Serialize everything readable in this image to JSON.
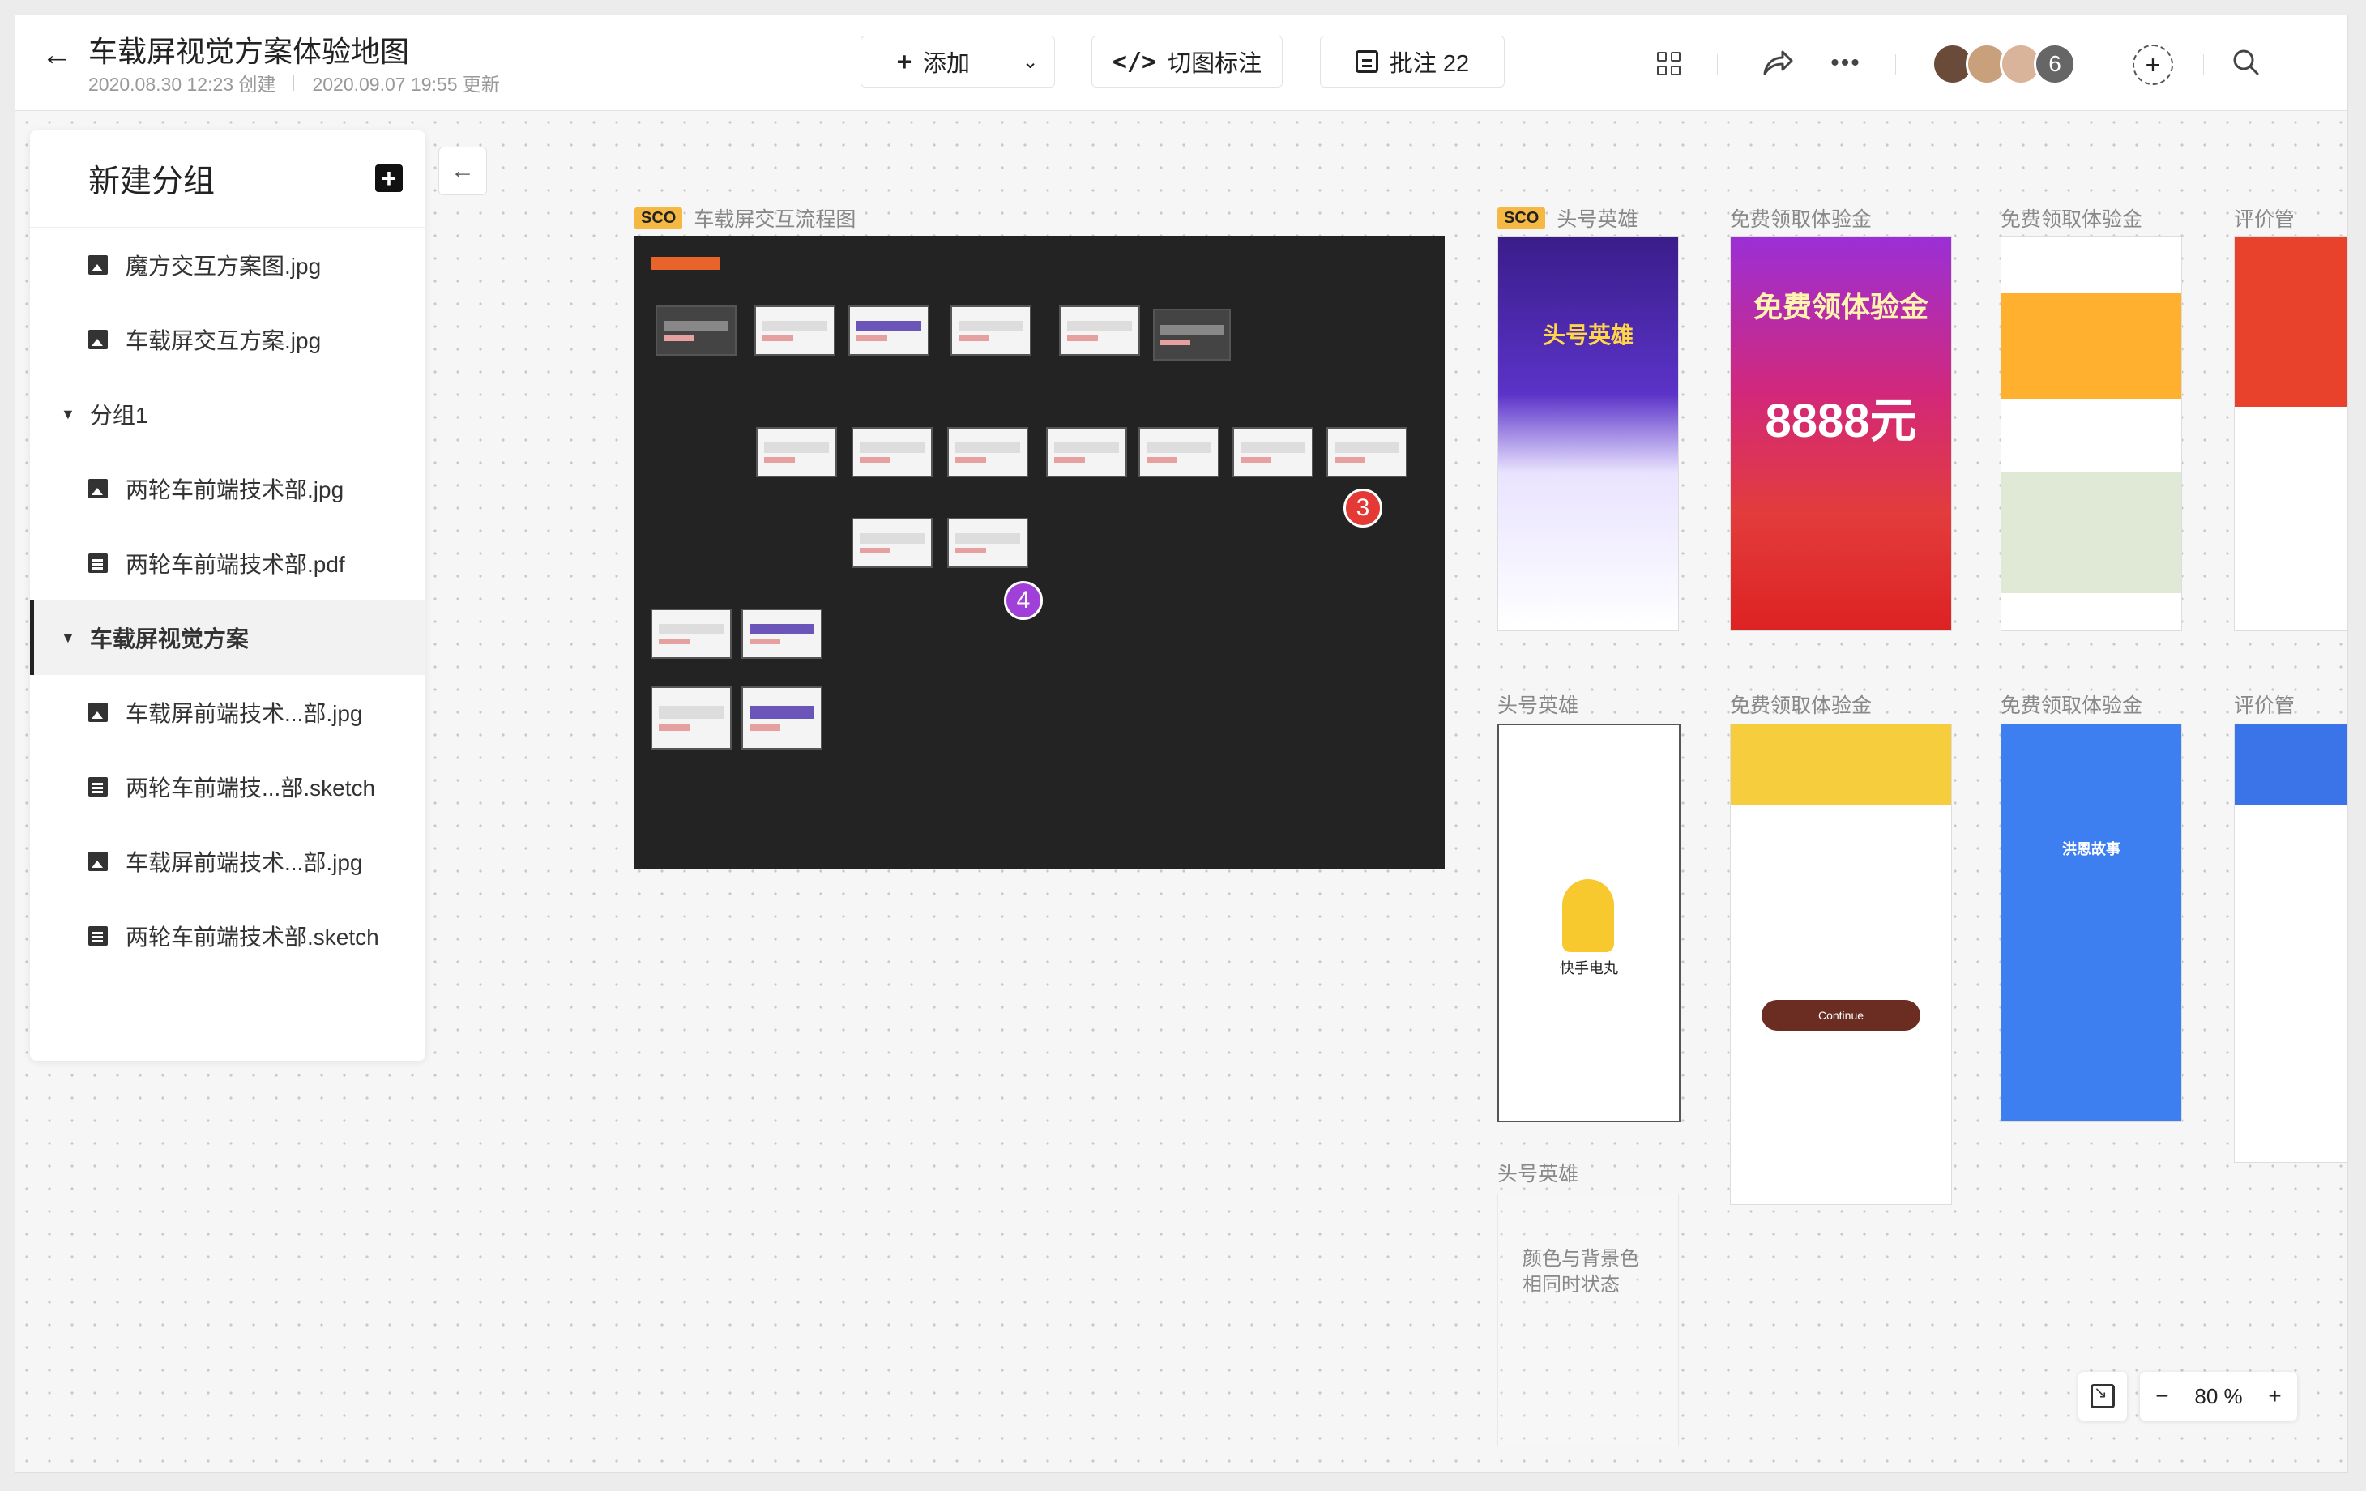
{
  "header": {
    "title": "车载屏视觉方案体验地图",
    "created": "2020.08.30 12:23 创建",
    "updated": "2020.09.07 19:55 更新",
    "add_label": "添加",
    "code_label": "切图标注",
    "notes_label": "批注 22",
    "member_count": "6",
    "avatar_colors": [
      "#6a4b3a",
      "#c8a07c",
      "#d9b39a"
    ]
  },
  "sidebar": {
    "title": "新建分组",
    "items": [
      {
        "label": "魔方交互方案图.jpg",
        "type": "image"
      },
      {
        "label": "车载屏交互方案.jpg",
        "type": "image"
      },
      {
        "label": "分组1",
        "type": "group"
      },
      {
        "label": "两轮车前端技术部.jpg",
        "type": "image"
      },
      {
        "label": "两轮车前端技术部.pdf",
        "type": "doc"
      },
      {
        "label": "车载屏视觉方案",
        "type": "group-active"
      },
      {
        "label": "车载屏前端技术...部.jpg",
        "type": "image"
      },
      {
        "label": "两轮车前端技...部.sketch",
        "type": "doc"
      },
      {
        "label": "车载屏前端技术...部.jpg",
        "type": "image"
      },
      {
        "label": "两轮车前端技术部.sketch",
        "type": "doc"
      }
    ]
  },
  "boards": {
    "sco_tag": "SCO",
    "flow_title": "车载屏交互流程图",
    "marker3": "3",
    "marker4": "4",
    "col1_row1": "头号英雄",
    "col2_row1": "免费领取体验金",
    "col3_row1": "免费领取体验金",
    "col4_row1": "评价管",
    "col1_row2": "头号英雄",
    "col2_row2": "免费领取体验金",
    "col3_row2": "免费领取体验金",
    "col4_row2": "评价管",
    "col1_row3": "头号英雄",
    "empty_note": "颜色与背景色相同时状态",
    "phone_hero_text": "头号英雄",
    "phone_gold_title": "免费领体验金",
    "phone_gold_amount": "8888元",
    "phone_kuaishou": "快手电丸",
    "phone_continue": "Continue",
    "phone_story": "洪恩故事"
  },
  "zoom": {
    "minus": "−",
    "value": "80 %",
    "plus": "+"
  }
}
